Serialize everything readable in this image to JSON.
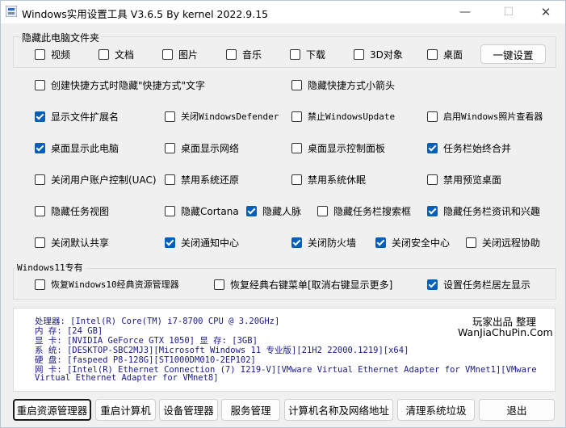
{
  "window": {
    "title": "Windows实用设置工具 V3.6.5 By kernel 2022.9.15"
  },
  "hide_group": {
    "label": "隐藏此电脑文件夹",
    "items": [
      {
        "label": "视频",
        "checked": false
      },
      {
        "label": "文档",
        "checked": false
      },
      {
        "label": "图片",
        "checked": false
      },
      {
        "label": "音乐",
        "checked": false
      },
      {
        "label": "下载",
        "checked": false
      },
      {
        "label": "3D对象",
        "checked": false
      },
      {
        "label": "桌面",
        "checked": false
      }
    ],
    "setup_button": "一键设置"
  },
  "options": {
    "shortcut_text": {
      "label": "创建快捷方式时隐藏\"快捷方式\"文字",
      "checked": false
    },
    "shortcut_arrow": {
      "label": "隐藏快捷方式小箭头",
      "checked": false
    },
    "show_ext": {
      "label": "显示文件扩展名",
      "checked": true
    },
    "disable_defender": {
      "label": "关闭WindowsDefender",
      "checked": false
    },
    "disable_update": {
      "label": "禁止WindowsUpdate",
      "checked": false
    },
    "photo_viewer": {
      "label": "启用Windows照片查看器",
      "checked": false
    },
    "desktop_pc": {
      "label": "桌面显示此电脑",
      "checked": true
    },
    "desktop_network": {
      "label": "桌面显示网络",
      "checked": false
    },
    "desktop_control": {
      "label": "桌面显示控制面板",
      "checked": false
    },
    "taskbar_combine": {
      "label": "任务栏始终合并",
      "checked": true
    },
    "disable_uac": {
      "label": "关闭用户账户控制(UAC)",
      "checked": false
    },
    "disable_restore": {
      "label": "禁用系统还原",
      "checked": false
    },
    "disable_hibernate": {
      "label": "禁用系统休眠",
      "checked": false
    },
    "disable_preview": {
      "label": "禁用预览桌面",
      "checked": false
    },
    "hide_taskview": {
      "label": "隐藏任务视图",
      "checked": false
    },
    "hide_cortana": {
      "label": "隐藏Cortana",
      "checked": false
    },
    "hide_people": {
      "label": "隐藏人脉",
      "checked": true
    },
    "hide_searchbox": {
      "label": "隐藏任务栏搜索框",
      "checked": false
    },
    "hide_news": {
      "label": "隐藏任务栏资讯和兴趣",
      "checked": true
    },
    "disable_share": {
      "label": "关闭默认共享",
      "checked": false
    },
    "disable_notify": {
      "label": "关闭通知中心",
      "checked": true
    },
    "disable_firewall": {
      "label": "关闭防火墙",
      "checked": true
    },
    "disable_security": {
      "label": "关闭安全中心",
      "checked": true
    },
    "disable_remote": {
      "label": "关闭远程协助",
      "checked": false
    }
  },
  "win11_group": {
    "label": "Windows11专有",
    "items": [
      {
        "label": "恢复Windows10经典资源管理器",
        "checked": false
      },
      {
        "label": "恢复经典右键菜单[取消右键显示更多]",
        "checked": false
      },
      {
        "label": "设置任务栏居左显示",
        "checked": true
      }
    ]
  },
  "sysinfo": {
    "cpu": "处理器: [Intel(R) Core(TM) i7-8700 CPU @ 3.20GHz]",
    "mem": "内  存: [24 GB]",
    "gpu": "显  卡: [NVIDIA GeForce GTX 1050]  显 存: [3GB]",
    "os": "系  统: [DESKTOP-SBC2MJ3][Microsoft Windows 11 专业版][21H2 22000.1219][x64]",
    "disk": "硬  盘: [faspeed P8-128G][ST1000DM010-2EP102]",
    "net1": "网  卡: [Intel(R) Ethernet Connection (7) I219-V][VMware Virtual Ethernet Adapter for VMnet1][VMware",
    "net2": "Virtual Ethernet Adapter for VMnet8]",
    "brand1": "玩家出品 整理",
    "brand2": "WanJiaChuPin.Com"
  },
  "buttons": {
    "restart_explorer": "重启资源管理器",
    "restart_pc": "重启计算机",
    "device_manager": "设备管理器",
    "service_manager": "服务管理",
    "pc_name_ip": "计算机名称及网络地址",
    "clean_junk": "清理系统垃圾",
    "exit": "退出"
  }
}
